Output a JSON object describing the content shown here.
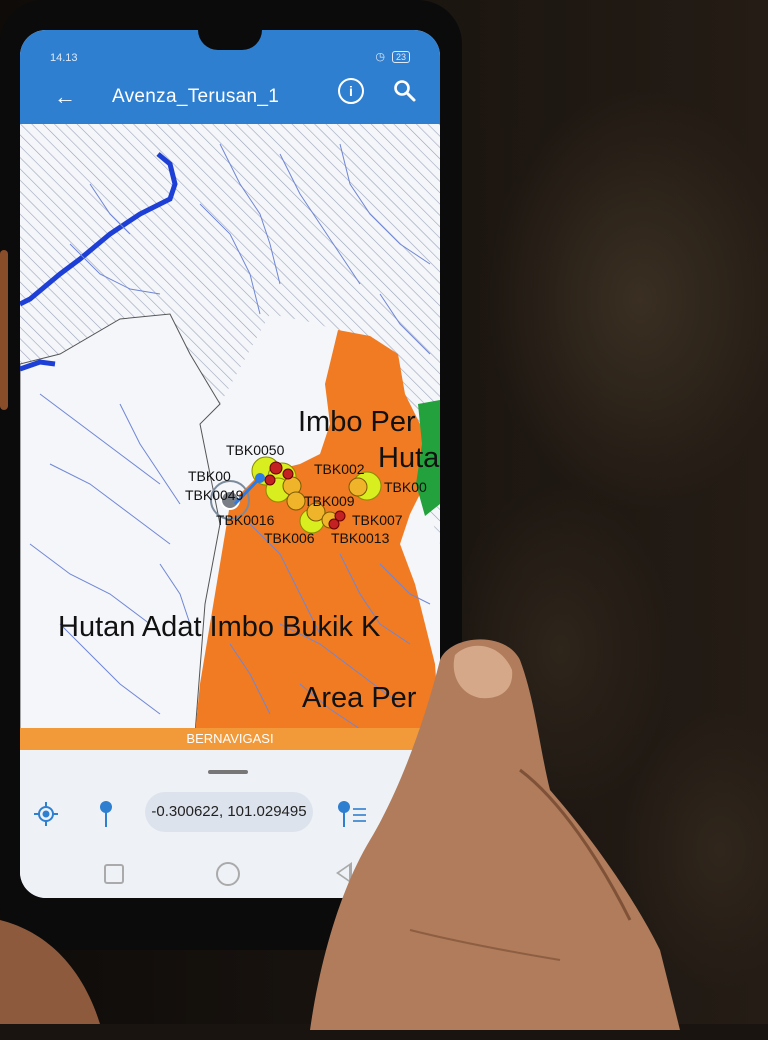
{
  "status_bar": {
    "time": "14.13",
    "battery": "23"
  },
  "app_bar": {
    "title": "Avenza_Terusan_1",
    "back_icon": "arrow-left-icon",
    "info_icon": "info-icon",
    "search_icon": "search-icon"
  },
  "map": {
    "area_labels": [
      "Imbo Per",
      "Huta",
      "Hutan Adat Imbo Bukik K",
      "Area Per"
    ],
    "waypoints": [
      "TBK0050",
      "TBK00",
      "TBK0049",
      "TBK002",
      "TBK00",
      "TBK009",
      "TBK0016",
      "TBK007",
      "TBK006",
      "TBK0013"
    ],
    "colors": {
      "protected_area": "#f07b22",
      "forest": "#23a13c",
      "river": "#1d3fd6",
      "streams": "#6f86d6"
    }
  },
  "nav_banner": "BERNAVIGASI",
  "bottom_sheet": {
    "coordinates": "-0.300622, 101.029495",
    "gps_icon": "gps-locate-icon",
    "pin_icon": "pin-icon",
    "pin_list_icon": "pin-list-icon"
  },
  "system_nav": {
    "recents": "square-icon",
    "home": "circle-icon",
    "back": "triangle-back-icon"
  }
}
